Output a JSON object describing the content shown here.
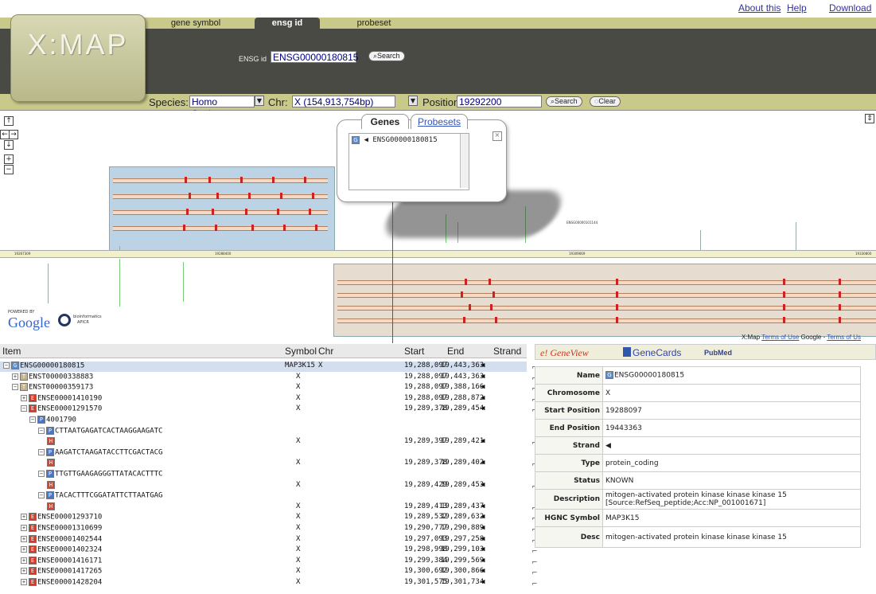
{
  "top_links": {
    "about": "About this",
    "help": "Help",
    "download": "Download"
  },
  "logo": "X:MAP",
  "search_tabs": [
    "gene symbol",
    "ensg id",
    "probeset"
  ],
  "ensg_label": "ENSG id",
  "ensg_value": "ENSG00000180815",
  "search_btn": "Search",
  "clear_btn": "Clear",
  "species_label": "Species:",
  "species_value": "Homo Sapiens",
  "chr_label": "Chr:",
  "chr_value": "X (154,913,754bp)",
  "position_label": "Position:",
  "position_value": "19292200",
  "map": {
    "popup_tabs": [
      "Genes",
      "Probesets"
    ],
    "popup_item": "ENSG00000180815",
    "scale_labels": [
      "19267309",
      "19288400",
      "19309669",
      "19330800"
    ],
    "powered_by": "POWERED BY",
    "google": "Google",
    "bio_text": "bioinformatics",
    "bio_sub": "APICR",
    "footer_prefix": "X:Map",
    "footer_terms": "Terms of Use",
    "footer_google": "Google -",
    "footer_terms2": "Terms of Us"
  },
  "table": {
    "headers": {
      "item": "Item",
      "symbol": "Symbol",
      "chr": "Chr",
      "start": "Start",
      "end": "End",
      "strand": "Strand"
    },
    "rows": [
      {
        "item": "ENSG00000180815",
        "type": "G",
        "indent": 0,
        "pm": "−",
        "symbol": "MAP3K15",
        "chr": "X",
        "start": "19,288,097",
        "end": "19,443,363",
        "strand": "◀",
        "highlight": true
      },
      {
        "item": "ENST00000338883",
        "type": "T",
        "indent": 1,
        "pm": "+",
        "symbol": "",
        "chr": "X",
        "start": "19,288,097",
        "end": "19,443,363",
        "strand": "◀"
      },
      {
        "item": "ENST00000359173",
        "type": "T",
        "indent": 1,
        "pm": "−",
        "symbol": "",
        "chr": "X",
        "start": "19,288,097",
        "end": "19,388,166",
        "strand": "◀"
      },
      {
        "item": "ENSE00001410190",
        "type": "E",
        "indent": 2,
        "pm": "+",
        "symbol": "",
        "chr": "X",
        "start": "19,288,097",
        "end": "19,288,872",
        "strand": "◀"
      },
      {
        "item": "ENSE00001291570",
        "type": "E",
        "indent": 2,
        "pm": "−",
        "symbol": "",
        "chr": "X",
        "start": "19,289,378",
        "end": "19,289,454",
        "strand": "◀"
      },
      {
        "item": "4001790",
        "type": "P",
        "indent": 3,
        "pm": "−",
        "symbol": "",
        "chr": "",
        "start": "",
        "end": "",
        "strand": ""
      },
      {
        "item": "CTTAATGAGATCACTAAGGAAGATC",
        "type": "P",
        "indent": 4,
        "pm": "−",
        "symbol": "",
        "chr": "",
        "start": "",
        "end": "",
        "strand": ""
      },
      {
        "item": "",
        "type": "H",
        "indent": 5,
        "pm": "",
        "symbol": "",
        "chr": "X",
        "start": "19,289,397",
        "end": "19,289,421",
        "strand": "◀"
      },
      {
        "item": "AAGATCTAAGATACCTTCGACTACG",
        "type": "P",
        "indent": 4,
        "pm": "−",
        "symbol": "",
        "chr": "",
        "start": "",
        "end": "",
        "strand": ""
      },
      {
        "item": "",
        "type": "H",
        "indent": 5,
        "pm": "",
        "symbol": "",
        "chr": "X",
        "start": "19,289,378",
        "end": "19,289,402",
        "strand": "◀"
      },
      {
        "item": "TTGTTGAAGAGGGTTATACACTTTC",
        "type": "P",
        "indent": 4,
        "pm": "−",
        "symbol": "",
        "chr": "",
        "start": "",
        "end": "",
        "strand": ""
      },
      {
        "item": "",
        "type": "H",
        "indent": 5,
        "pm": "",
        "symbol": "",
        "chr": "X",
        "start": "19,289,429",
        "end": "19,289,453",
        "strand": "◀"
      },
      {
        "item": "TACACTTTCGGATATTCTTAATGAG",
        "type": "P",
        "indent": 4,
        "pm": "−",
        "symbol": "",
        "chr": "",
        "start": "",
        "end": "",
        "strand": ""
      },
      {
        "item": "",
        "type": "H",
        "indent": 5,
        "pm": "",
        "symbol": "",
        "chr": "X",
        "start": "19,289,413",
        "end": "19,289,437",
        "strand": "◀"
      },
      {
        "item": "ENSE00001293710",
        "type": "E",
        "indent": 2,
        "pm": "+",
        "symbol": "",
        "chr": "X",
        "start": "19,289,532",
        "end": "19,289,632",
        "strand": "◀"
      },
      {
        "item": "ENSE00001310699",
        "type": "E",
        "indent": 2,
        "pm": "+",
        "symbol": "",
        "chr": "X",
        "start": "19,290,777",
        "end": "19,290,889",
        "strand": "◀"
      },
      {
        "item": "ENSE00001402544",
        "type": "E",
        "indent": 2,
        "pm": "+",
        "symbol": "",
        "chr": "X",
        "start": "19,297,093",
        "end": "19,297,258",
        "strand": "◀"
      },
      {
        "item": "ENSE00001402324",
        "type": "E",
        "indent": 2,
        "pm": "+",
        "symbol": "",
        "chr": "X",
        "start": "19,298,998",
        "end": "19,299,103",
        "strand": "◀"
      },
      {
        "item": "ENSE00001416171",
        "type": "E",
        "indent": 2,
        "pm": "+",
        "symbol": "",
        "chr": "X",
        "start": "19,299,384",
        "end": "19,299,569",
        "strand": "◀"
      },
      {
        "item": "ENSE00001417265",
        "type": "E",
        "indent": 2,
        "pm": "+",
        "symbol": "",
        "chr": "X",
        "start": "19,300,692",
        "end": "19,300,866",
        "strand": "◀"
      },
      {
        "item": "ENSE00001428204",
        "type": "E",
        "indent": 2,
        "pm": "+",
        "symbol": "",
        "chr": "X",
        "start": "19,301,575",
        "end": "19,301,734",
        "strand": "◀"
      }
    ]
  },
  "details_tabs": {
    "geneview": "e! GeneView",
    "genecards": "GeneCards",
    "pubmed": "PubMed"
  },
  "details": [
    {
      "k": "Name",
      "v": "ENSG00000180815"
    },
    {
      "k": "Chromosome",
      "v": "X"
    },
    {
      "k": "Start Position",
      "v": "19288097"
    },
    {
      "k": "End Position",
      "v": "19443363"
    },
    {
      "k": "Strand",
      "v": "◀"
    },
    {
      "k": "Type",
      "v": "protein_coding"
    },
    {
      "k": "Status",
      "v": "KNOWN"
    },
    {
      "k": "Description",
      "v": "mitogen-activated protein kinase kinase kinase 15 [Source:RefSeq_peptide;Acc:NP_001001671]"
    },
    {
      "k": "HGNC Symbol",
      "v": "MAP3K15"
    },
    {
      "k": "Desc",
      "v": "mitogen-activated protein kinase kinase kinase 15"
    }
  ]
}
